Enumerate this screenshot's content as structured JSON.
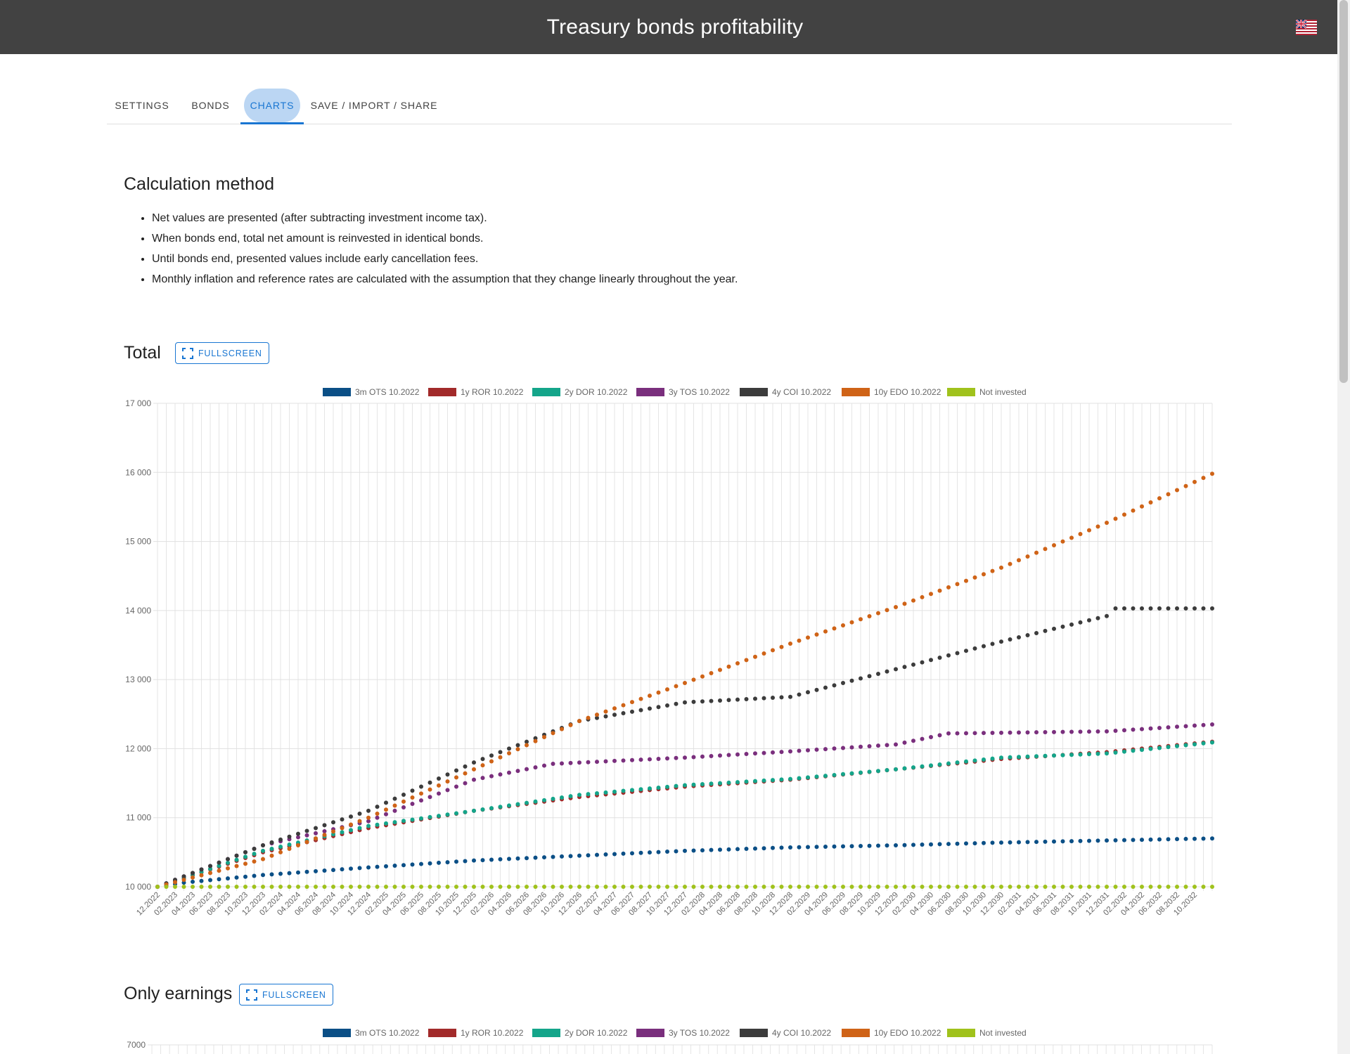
{
  "app": {
    "title": "Treasury bonds profitability",
    "flag_icon": "uk-flag-icon"
  },
  "tabs": [
    {
      "label": "SETTINGS",
      "active": false
    },
    {
      "label": "BONDS",
      "active": false
    },
    {
      "label": "CHARTS",
      "active": true
    },
    {
      "label": "SAVE / IMPORT / SHARE",
      "active": false
    }
  ],
  "method": {
    "title": "Calculation method",
    "items": [
      "Net values are presented (after subtracting investment income tax).",
      "When bonds end, total net amount is reinvested in identical bonds.",
      "Until bonds end, presented values include early cancellation fees.",
      "Monthly inflation and reference rates are calculated with the assumption that they change linearly throughout the year."
    ]
  },
  "fullscreen_label": "FULLSCREEN",
  "colors": {
    "accent": "#1976d2",
    "ots": "#0b4f86",
    "ror": "#a22a2a",
    "dor": "#14a58a",
    "tos": "#7a2f7d",
    "coi": "#3c3c3c",
    "edo": "#cf6317",
    "none": "#a0c21c"
  },
  "chart_data": [
    {
      "type": "scatter",
      "title": "Total",
      "ylim": [
        10000,
        17000
      ],
      "yticks": [
        "10 000",
        "11 000",
        "12 000",
        "13 000",
        "14 000",
        "15 000",
        "16 000",
        "17 000"
      ],
      "xticks": [
        "12.2022",
        "02.2023",
        "04.2023",
        "06.2023",
        "08.2023",
        "10.2023",
        "12.2023",
        "02.2024",
        "04.2024",
        "06.2024",
        "08.2024",
        "10.2024",
        "12.2024",
        "02.2025",
        "04.2025",
        "06.2025",
        "08.2025",
        "10.2025",
        "12.2025",
        "02.2026",
        "04.2026",
        "06.2026",
        "08.2026",
        "10.2026",
        "12.2026",
        "02.2027",
        "04.2027",
        "06.2027",
        "08.2027",
        "10.2027",
        "12.2027",
        "02.2028",
        "04.2028",
        "06.2028",
        "08.2028",
        "10.2028",
        "12.2028",
        "02.2029",
        "04.2029",
        "06.2029",
        "08.2029",
        "10.2029",
        "12.2029",
        "02.2030",
        "04.2030",
        "06.2030",
        "08.2030",
        "10.2030",
        "12.2030",
        "02.2031",
        "04.2031",
        "06.2031",
        "08.2031",
        "10.2031",
        "12.2031",
        "02.2032",
        "04.2032",
        "06.2032",
        "08.2032",
        "10.2032"
      ],
      "x_months": 121,
      "grid": true,
      "legend_position": "top",
      "series": [
        {
          "name": "3m OTS 10.2022",
          "color": "#0b4f86",
          "anchors": [
            [
              0,
              10000
            ],
            [
              3,
              10060
            ],
            [
              12,
              10170
            ],
            [
              24,
              10280
            ],
            [
              36,
              10380
            ],
            [
              48,
              10450
            ],
            [
              60,
              10520
            ],
            [
              72,
              10570
            ],
            [
              84,
              10600
            ],
            [
              96,
              10640
            ],
            [
              108,
              10670
            ],
            [
              120,
              10700
            ],
            [
              121,
              10750
            ]
          ]
        },
        {
          "name": "1y ROR 10.2022",
          "color": "#a22a2a",
          "anchors": [
            [
              0,
              10000
            ],
            [
              12,
              10500
            ],
            [
              24,
              10850
            ],
            [
              36,
              11100
            ],
            [
              48,
              11300
            ],
            [
              60,
              11450
            ],
            [
              72,
              11550
            ],
            [
              84,
              11700
            ],
            [
              96,
              11850
            ],
            [
              108,
              11950
            ],
            [
              120,
              12100
            ],
            [
              121,
              12200
            ]
          ]
        },
        {
          "name": "2y DOR 10.2022",
          "color": "#14a58a",
          "anchors": [
            [
              0,
              10000
            ],
            [
              12,
              10520
            ],
            [
              24,
              10880
            ],
            [
              36,
              11100
            ],
            [
              48,
              11330
            ],
            [
              60,
              11470
            ],
            [
              72,
              11560
            ],
            [
              84,
              11700
            ],
            [
              96,
              11870
            ],
            [
              108,
              11930
            ],
            [
              120,
              12090
            ],
            [
              121,
              12200
            ]
          ]
        },
        {
          "name": "3y TOS 10.2022",
          "color": "#7a2f7d",
          "anchors": [
            [
              0,
              10000
            ],
            [
              12,
              10600
            ],
            [
              24,
              10950
            ],
            [
              36,
              11550
            ],
            [
              45,
              11780
            ],
            [
              60,
              11870
            ],
            [
              72,
              11960
            ],
            [
              84,
              12060
            ],
            [
              90,
              12220
            ],
            [
              108,
              12250
            ],
            [
              120,
              12350
            ],
            [
              121,
              12450
            ]
          ]
        },
        {
          "name": "4y COI 10.2022",
          "color": "#3c3c3c",
          "anchors": [
            [
              0,
              10000
            ],
            [
              12,
              10600
            ],
            [
              24,
              11100
            ],
            [
              36,
              11800
            ],
            [
              48,
              12400
            ],
            [
              60,
              12670
            ],
            [
              72,
              12750
            ],
            [
              84,
              13150
            ],
            [
              96,
              13550
            ],
            [
              108,
              13920
            ],
            [
              109,
              14030
            ],
            [
              120,
              14030
            ],
            [
              121,
              14350
            ]
          ]
        },
        {
          "name": "10y EDO 10.2022",
          "color": "#cf6317",
          "anchors": [
            [
              0,
              10000
            ],
            [
              12,
              10400
            ],
            [
              24,
              11000
            ],
            [
              36,
              11700
            ],
            [
              48,
              12400
            ],
            [
              60,
              12950
            ],
            [
              72,
              13520
            ],
            [
              84,
              14050
            ],
            [
              96,
              14620
            ],
            [
              108,
              15270
            ],
            [
              120,
              15980
            ],
            [
              121,
              16650
            ]
          ]
        },
        {
          "name": "Not invested",
          "color": "#a0c21c",
          "anchors": [
            [
              0,
              10000
            ],
            [
              121,
              10000
            ]
          ]
        }
      ]
    },
    {
      "type": "scatter",
      "title": "Only earnings",
      "ylim": [
        0,
        7000
      ],
      "yticks": [
        "7000"
      ],
      "legend_position": "top",
      "series": [
        {
          "name": "3m OTS 10.2022",
          "color": "#0b4f86"
        },
        {
          "name": "1y ROR 10.2022",
          "color": "#a22a2a"
        },
        {
          "name": "2y DOR 10.2022",
          "color": "#14a58a"
        },
        {
          "name": "3y TOS 10.2022",
          "color": "#7a2f7d"
        },
        {
          "name": "4y COI 10.2022",
          "color": "#3c3c3c"
        },
        {
          "name": "10y EDO 10.2022",
          "color": "#cf6317"
        },
        {
          "name": "Not invested",
          "color": "#a0c21c"
        }
      ]
    }
  ]
}
